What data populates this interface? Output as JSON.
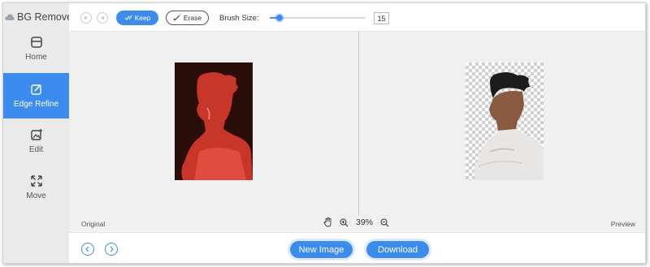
{
  "app": {
    "title": "BG Remover"
  },
  "sidebar": {
    "items": [
      {
        "label": "Home",
        "icon": "home-icon",
        "active": false
      },
      {
        "label": "Edge Refine",
        "icon": "edge-refine-icon",
        "active": true
      },
      {
        "label": "Edit",
        "icon": "edit-image-icon",
        "active": false
      },
      {
        "label": "Move",
        "icon": "move-icon",
        "active": false
      }
    ]
  },
  "toolbar": {
    "keep_label": "Keep",
    "erase_label": "Erase",
    "brush_size_label": "Brush Size:",
    "brush_size_value": "15",
    "brush_size_fraction": 0.1
  },
  "canvas": {
    "original_label": "Original",
    "preview_label": "Preview",
    "zoom_value": "39%"
  },
  "footer": {
    "new_image_label": "New Image",
    "download_label": "Download"
  },
  "colors": {
    "accent": "#3c8cf0",
    "sidebar_bg": "#eaeaea",
    "keep_overlay": "#d63a2c"
  }
}
